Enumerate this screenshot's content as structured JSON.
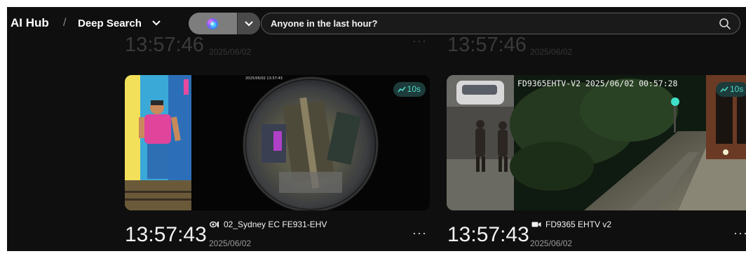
{
  "header": {
    "brand": "AI Hub",
    "separator": "/",
    "breadcrumb": "Deep Search",
    "search_query": "Anyone in the last hour?"
  },
  "previous_row": [
    {
      "time": "13:57:46",
      "date": "2025/06/02",
      "more": "···"
    },
    {
      "time": "13:57:46",
      "date": "2025/06/02",
      "more": "···"
    }
  ],
  "cards": [
    {
      "time": "13:57:43",
      "camera": "02_Sydney EC FE931-EHV",
      "date": "2025/06/02",
      "duration": "10s",
      "more": "···",
      "overlay": "2025/06/02 13:57:43"
    },
    {
      "time": "13:57:43",
      "camera": "FD9365 EHTV v2",
      "date": "2025/06/02",
      "duration": "10s",
      "more": "···",
      "overlay": "FD9365EHTV-V2 2025/06/02 00:57:28"
    }
  ],
  "colors": {
    "background": "#0f0f0f",
    "accent_teal": "#4fd6c7",
    "badge_bg": "#1d3b3a",
    "text_primary": "#f2f2f2",
    "text_secondary": "#9a9a9a"
  },
  "icons": {
    "breadcrumb_dropdown": "chevron-down-icon",
    "assistant": "ai-orb-icon",
    "assistant_dropdown": "chevron-down-icon",
    "search": "search-icon",
    "duration": "trend-icon",
    "fisheye_camera": "fisheye-camera-icon",
    "bullet_camera": "video-camera-icon",
    "more": "more-icon"
  }
}
